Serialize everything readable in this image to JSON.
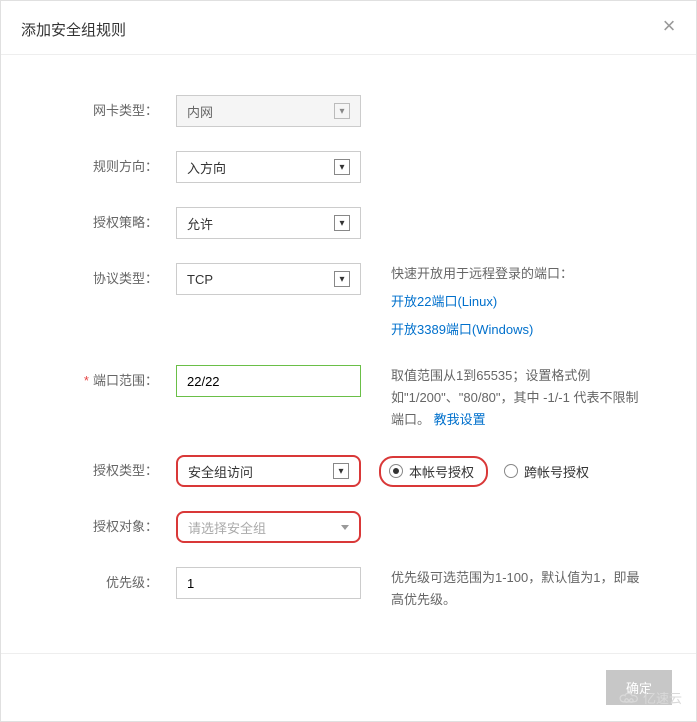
{
  "modal": {
    "title": "添加安全组规则"
  },
  "form": {
    "nic_type": {
      "label": "网卡类型：",
      "value": "内网"
    },
    "direction": {
      "label": "规则方向：",
      "value": "入方向"
    },
    "policy": {
      "label": "授权策略：",
      "value": "允许"
    },
    "protocol": {
      "label": "协议类型：",
      "value": "TCP",
      "help_intro": "快速开放用于远程登录的端口：",
      "link_linux": "开放22端口(Linux)",
      "link_windows": "开放3389端口(Windows)"
    },
    "port_range": {
      "label": "端口范围：",
      "value": "22/22",
      "help_text": "取值范围从1到65535；设置格式例如\"1/200\"、\"80/80\"，其中 -1/-1 代表不限制端口。",
      "help_link": "教我设置"
    },
    "auth_type": {
      "label": "授权类型：",
      "value": "安全组访问",
      "radio_same_account": "本帐号授权",
      "radio_cross_account": "跨帐号授权"
    },
    "auth_object": {
      "label": "授权对象：",
      "placeholder": "请选择安全组"
    },
    "priority": {
      "label": "优先级：",
      "value": "1",
      "help_text": "优先级可选范围为1-100，默认值为1，即最高优先级。"
    }
  },
  "footer": {
    "confirm": "确定"
  },
  "watermark": "亿速云"
}
